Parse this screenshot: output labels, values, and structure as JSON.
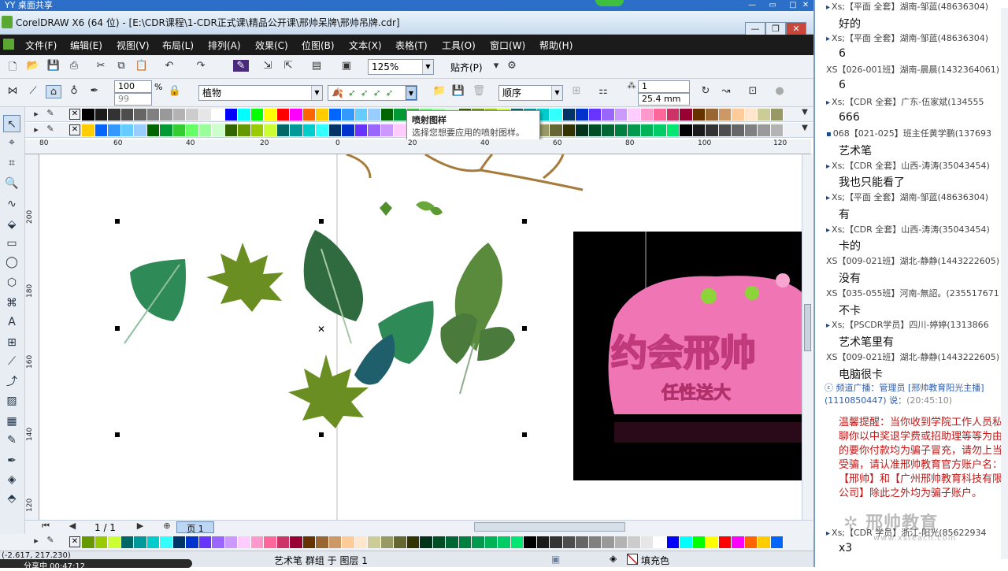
{
  "yy": {
    "title": "YY 桌面共享"
  },
  "window": {
    "title": "CorelDRAW X6 (64 位) - [E:\\CDR课程\\1-CDR正式课\\精品公开课\\邢帅呆牌\\邢帅吊牌.cdr]"
  },
  "menu": [
    "文件(F)",
    "编辑(E)",
    "视图(V)",
    "布局(L)",
    "排列(A)",
    "效果(C)",
    "位图(B)",
    "文本(X)",
    "表格(T)",
    "工具(O)",
    "窗口(W)",
    "帮助(H)"
  ],
  "toolbar": {
    "zoom": "125%",
    "snap": "贴齐(P)"
  },
  "propbar": {
    "size1": "100",
    "size2": "99",
    "percent": "%",
    "category": "植物",
    "order": "顺序",
    "count": "1",
    "spacing": "25.4 mm"
  },
  "tooltip": {
    "title": "喷射图样",
    "text": "选择您想要应用的喷射图样。"
  },
  "ruler": {
    "h": [
      "80",
      "60",
      "40",
      "20",
      "0",
      "20",
      "40",
      "60",
      "80",
      "100",
      "120"
    ],
    "v": [
      "200",
      "180",
      "160",
      "140",
      "120"
    ]
  },
  "pagebar": {
    "count": "1 / 1",
    "tab": "页 1"
  },
  "status": {
    "coords": "(-2.617, 217.230)",
    "object": "艺术笔 群组 于 图层 1",
    "fill": "填充色",
    "sharing": "分享中 00:47:12"
  },
  "chat": [
    {
      "user": "Xs;【平面 全套】湖南-邹蓝(48636304)",
      "msg": "好的"
    },
    {
      "user": "Xs;【平面 全套】湖南-邹蓝(48636304)",
      "msg": "6"
    },
    {
      "user": "XS【026-001班】湖南-晨晨(1432364061)",
      "msg": "6"
    },
    {
      "user": "Xs;【CDR 全套】广东-伍家斌(134555",
      "msg": "666"
    },
    {
      "user": "068【021-025】班主任黄学鹏(137693",
      "msg": "艺术笔"
    },
    {
      "user": "Xs;【CDR 全套】山西-涛涛(35043454)",
      "msg": "我也只能看了"
    },
    {
      "user": "Xs;【平面 全套】湖南-邹蓝(48636304)",
      "msg": "有"
    },
    {
      "user": "Xs;【CDR 全套】山西-涛涛(35043454)",
      "msg": "卡的"
    },
    {
      "user": "XS【009-021班】湖北-静静(1443222605)",
      "msg": "没有"
    },
    {
      "user": "XS【035-055班】河南-無詔。(235517671",
      "msg": "不卡"
    },
    {
      "user": "Xs;【PSCDR学员】四川-婷婷(1313866",
      "msg": "艺术笔里有"
    },
    {
      "user": "XS【009-021班】湖北-静静(1443222605)",
      "msg": "电脑很卡"
    }
  ],
  "broadcast": {
    "label": "频道广播：管理员 [邢帅教育阳光主播](1110850447) 说：",
    "time": "(20:45:10)"
  },
  "warning": "温馨提醒：当你收到学院工作人员私聊你以中奖退学费或招助理等等为由的要你付款均为骗子冒充，请勿上当受骗，请认准邢帅教育官方账户名：【邢帅】和【广州邢帅教育科技有限公司】除此之外均为骗子账户。",
  "last": {
    "user": "Xs;【CDR 学员】浙江-阳光(85622934",
    "msg": "x3"
  },
  "watermark": {
    "name": "邢帅教育",
    "url": "www.xsteach.com"
  },
  "banner": {
    "text": "约会邢帅",
    "sub": "任性送大"
  },
  "palette": [
    "#000000",
    "#1a1a1a",
    "#333333",
    "#4d4d4d",
    "#666666",
    "#808080",
    "#999999",
    "#b3b3b3",
    "#cccccc",
    "#e6e6e6",
    "#ffffff",
    "#0000ff",
    "#00ffff",
    "#00ff00",
    "#ffff00",
    "#ff0000",
    "#ff00ff",
    "#ff6600",
    "#ffcc00",
    "#0066ff",
    "#3399ff",
    "#66ccff",
    "#99ccff",
    "#006600",
    "#009933",
    "#33cc33",
    "#66ff66",
    "#99ff99",
    "#ccffcc",
    "#336600",
    "#669900",
    "#99cc00",
    "#ccff33",
    "#006666",
    "#009999",
    "#00cccc",
    "#33ffff",
    "#003366",
    "#0033cc",
    "#6633ff",
    "#9966ff",
    "#cc99ff",
    "#ffccff",
    "#ff99cc",
    "#ff6699",
    "#cc3366",
    "#990033",
    "#663300",
    "#996633",
    "#cc9966",
    "#ffcc99",
    "#ffe6cc",
    "#cccc99",
    "#999966",
    "#666633",
    "#333300",
    "#00331a",
    "#004d26",
    "#006633",
    "#008040",
    "#00994d",
    "#00b359",
    "#00cc66",
    "#00e673"
  ]
}
